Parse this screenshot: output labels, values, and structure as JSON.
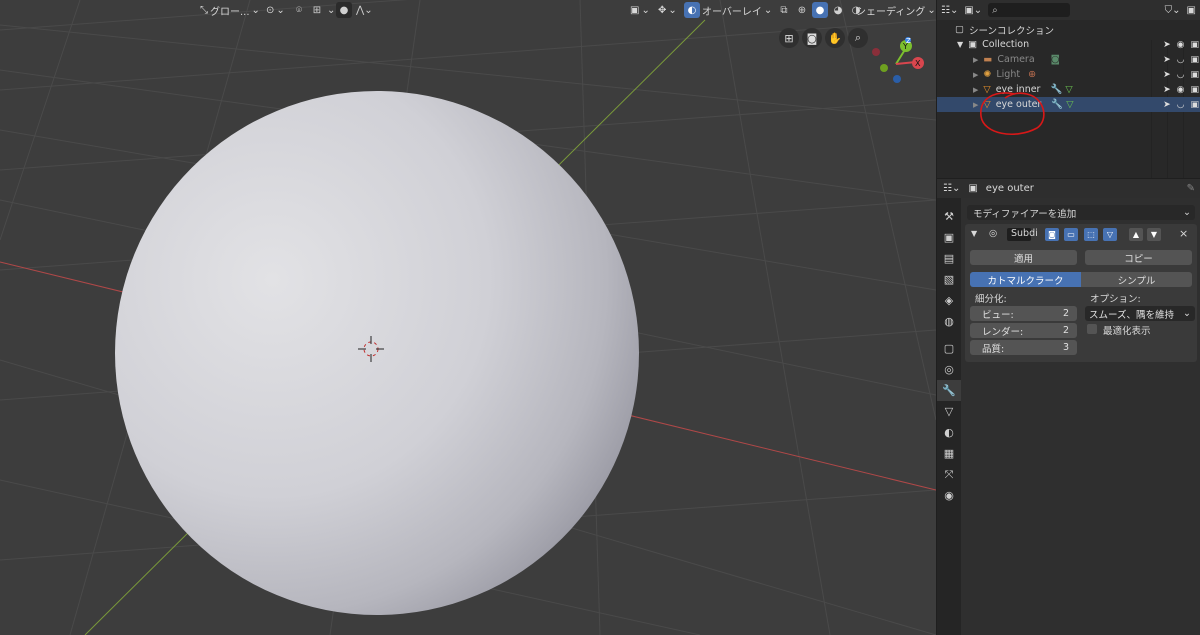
{
  "viewport_header": {
    "transform_orientation": "グロー...",
    "overlay_label": "オーバーレイ",
    "shading_label": "シェーディング"
  },
  "outliner": {
    "scene_collection": "シーンコレクション",
    "collection": "Collection",
    "items": [
      {
        "name": "Camera"
      },
      {
        "name": "Light"
      },
      {
        "name": "eye inner"
      },
      {
        "name": "eye outer"
      }
    ]
  },
  "properties": {
    "object_name": "eye outer",
    "add_modifier": "モディファイアーを追加",
    "modifier_name": "Subdi",
    "apply": "適用",
    "copy": "コピー",
    "catmull_clark": "カトマルクラーク",
    "simple": "シンプル",
    "subdivisions_label": "細分化:",
    "options_label": "オプション:",
    "view_label": "ビュー:",
    "view_value": "2",
    "render_label": "レンダー:",
    "render_value": "2",
    "quality_label": "品質:",
    "quality_value": "3",
    "uv_smooth": "スムーズ、隅を維持",
    "optimal_display": "最適化表示"
  },
  "colors": {
    "accent_blue": "#4772b3",
    "selected_row": "#33496b",
    "annotation_red": "#d81818",
    "axis_x": "#c84a4a",
    "axis_y": "#8ab040"
  }
}
